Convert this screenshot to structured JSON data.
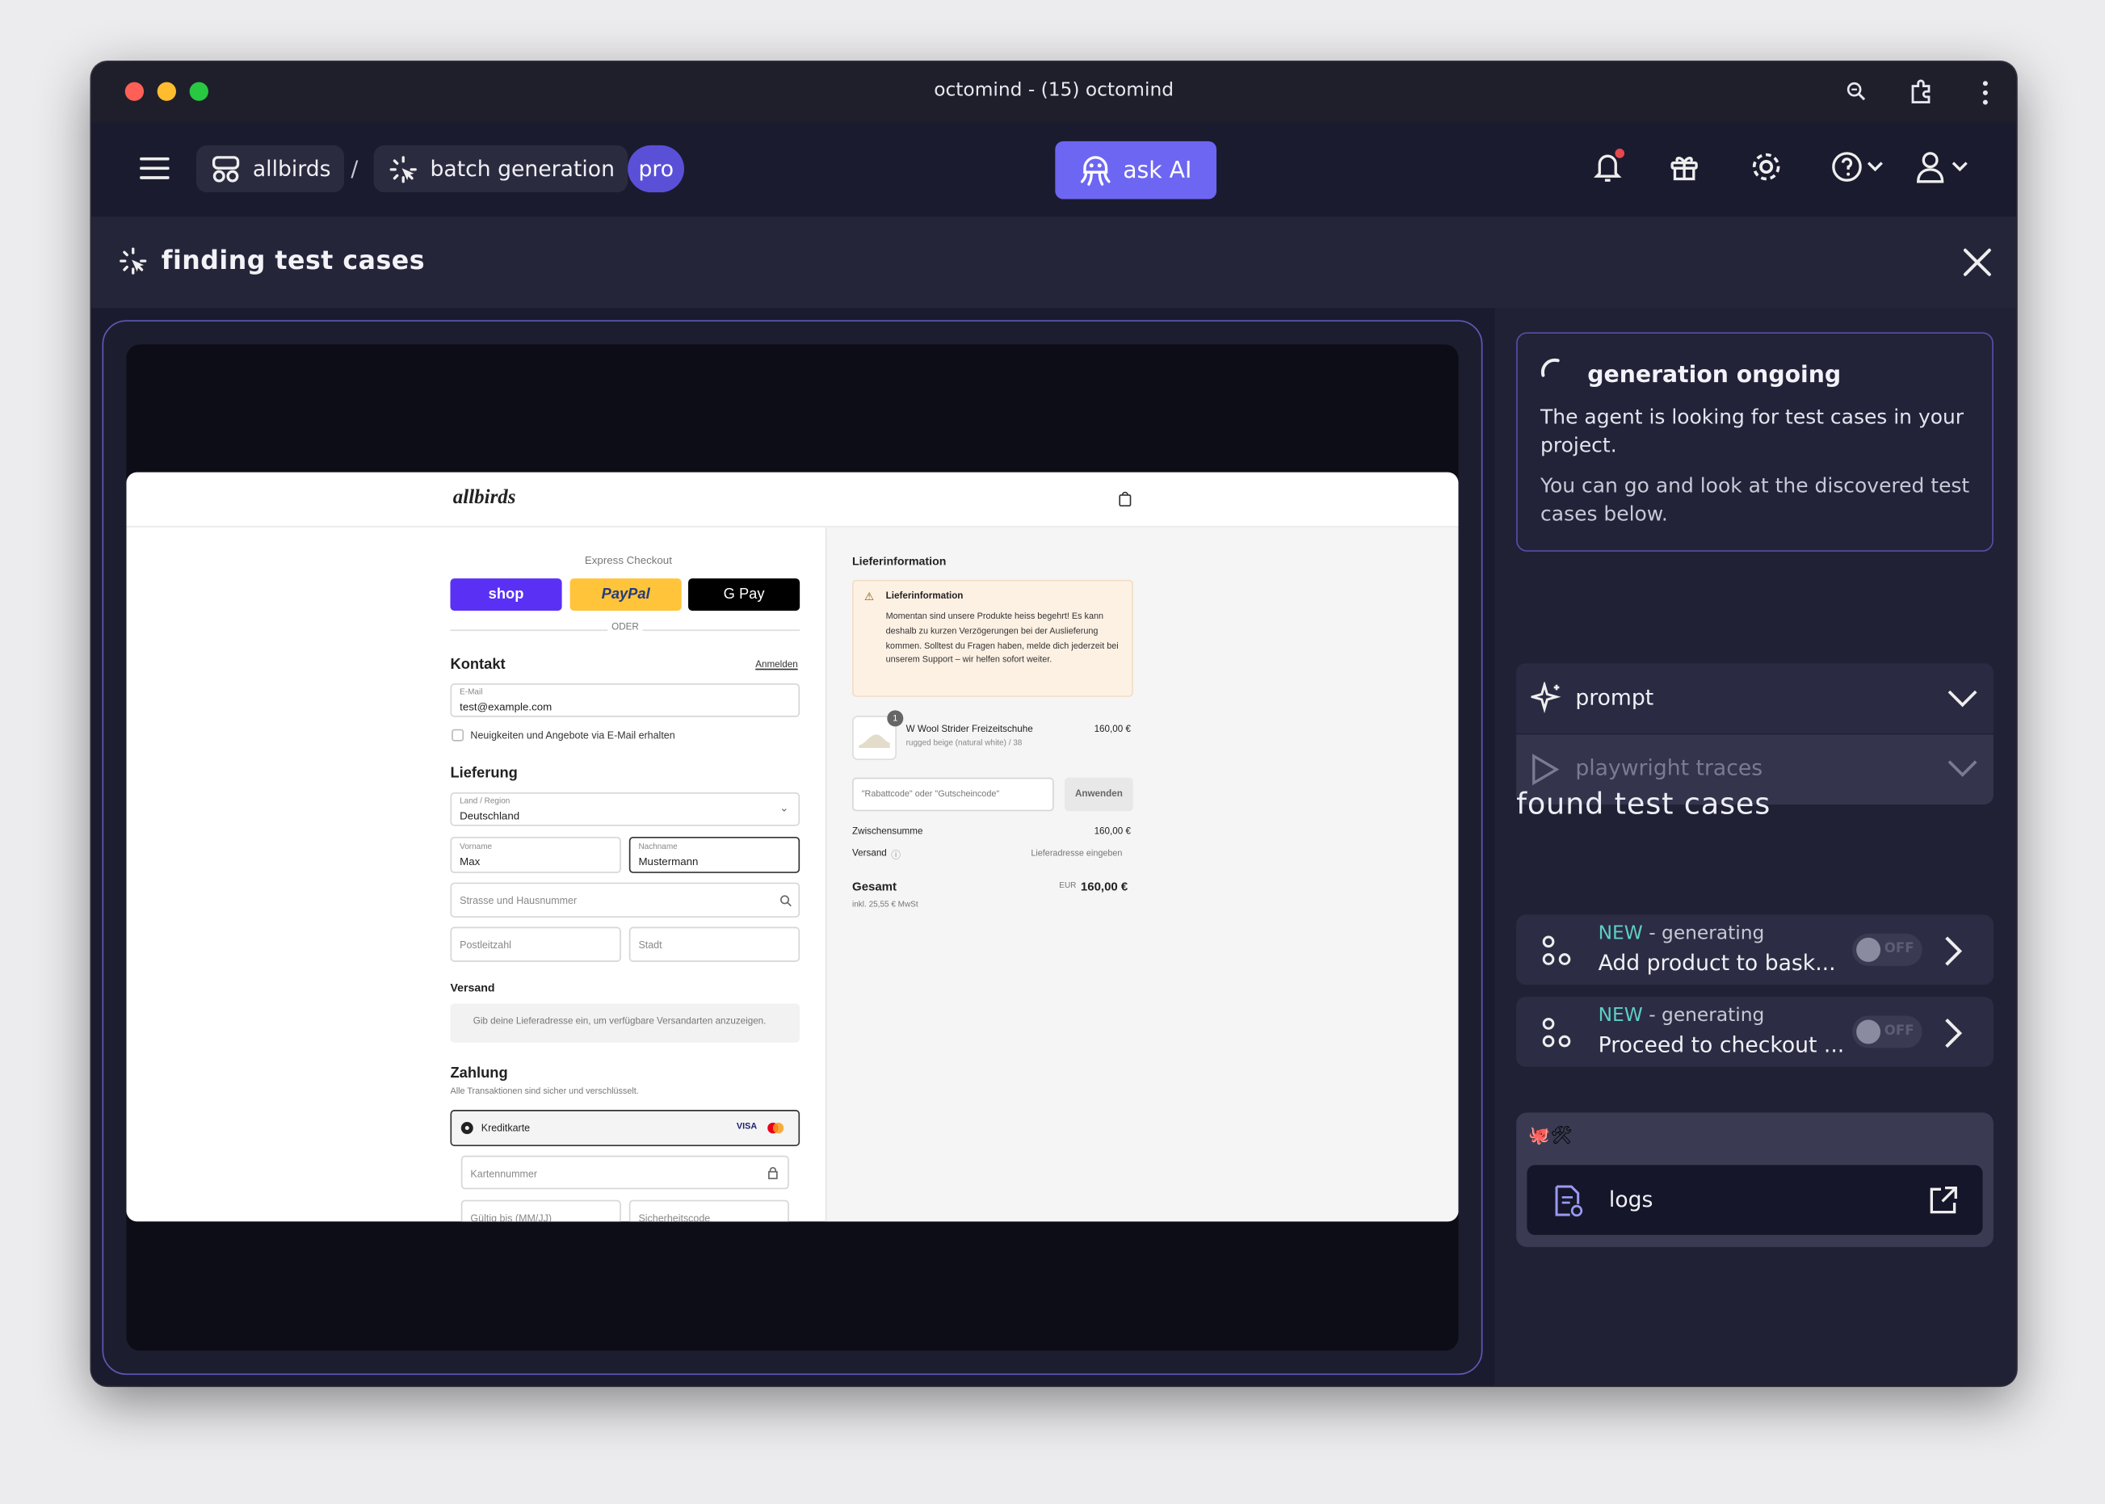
{
  "window": {
    "title": "octomind - (15) octomind"
  },
  "nav": {
    "project": "allbirds",
    "separator": "/",
    "page": "batch generation",
    "plan": "pro",
    "ask_ai": "ask AI"
  },
  "panel": {
    "title": "finding test cases"
  },
  "status": {
    "title": "generation ongoing",
    "line1": "The agent is looking for test cases in your project.",
    "line2": "You can go and look at the discovered test cases below."
  },
  "accordions": [
    {
      "label": "prompt",
      "icon": "sparkle-icon",
      "enabled": true
    },
    {
      "label": "playwright traces",
      "icon": "play-icon",
      "enabled": false
    }
  ],
  "found": {
    "title": "found test cases",
    "items": [
      {
        "badge": "NEW",
        "state": " - generating",
        "name": "Add product to bask...",
        "toggle": "OFF"
      },
      {
        "badge": "NEW",
        "state": " - generating",
        "name": "Proceed to checkout ...",
        "toggle": "OFF"
      }
    ]
  },
  "logs": {
    "emoji": "🐙🛠",
    "label": "logs"
  },
  "preview": {
    "brand": "allbirds",
    "express": "Express Checkout",
    "pay_shop": "shop",
    "pay_paypal": "PayPal",
    "pay_gpay": "G Pay",
    "or": "ODER",
    "contact": "Kontakt",
    "login": "Anmelden",
    "email_label": "E-Mail",
    "email_value": "test@example.com",
    "newsletter": "Neuigkeiten und Angebote via E-Mail erhalten",
    "delivery": "Lieferung",
    "country_label": "Land / Region",
    "country_value": "Deutschland",
    "first_label": "Vorname",
    "first_value": "Max",
    "last_label": "Nachname",
    "last_value": "Mustermann",
    "street": "Strasse und Hausnummer",
    "zip": "Postleitzahl",
    "city": "Stadt",
    "shipping": "Versand",
    "shipping_hint": "Gib deine Lieferadresse ein, um verfügbare Versandarten anzuzeigen.",
    "payment": "Zahlung",
    "payment_sub": "Alle Transaktionen sind sicher und verschlüsselt.",
    "card": "Kreditkarte",
    "visa": "VISA",
    "card_number": "Kartennummer",
    "expiry": "Gültig bis (MM/JJ)",
    "cvc": "Sicherheitscode",
    "info_title": "Lieferinformation",
    "notice_title": "Lieferinformation",
    "notice_text": "Momentan sind unsere Produkte heiss begehrt! Es kann deshalb zu kurzen Verzögerungen bei der Auslieferung kommen. Solltest du Fragen haben, melde dich jederzeit bei unserem Support – wir helfen sofort weiter.",
    "qty": "1",
    "product": "W Wool Strider Freizeitschuhe",
    "variant": "rugged beige (natural white) / 38",
    "price": "160,00 €",
    "discount": "\"Rabattcode\" oder \"Gutscheincode\"",
    "apply": "Anwenden",
    "subtotal_label": "Zwischensumme",
    "subtotal": "160,00 €",
    "ship_label": "Versand",
    "ship_value": "Lieferadresse eingeben",
    "total_label": "Gesamt",
    "currency": "EUR",
    "total": "160,00 €",
    "tax": "inkl. 25,55 € MwSt"
  }
}
